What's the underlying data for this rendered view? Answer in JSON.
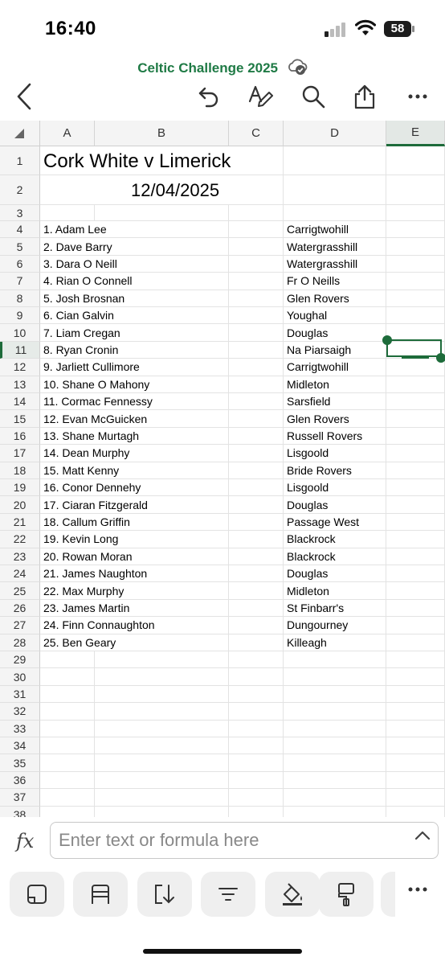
{
  "status": {
    "time": "16:40",
    "battery": "58"
  },
  "document": {
    "title": "Celtic Challenge 2025"
  },
  "toolbar": {
    "icons": [
      "back-icon",
      "undo-icon",
      "pen-format-icon",
      "search-icon",
      "share-icon",
      "more-icon"
    ]
  },
  "columns": [
    "A",
    "B",
    "C",
    "D",
    "E"
  ],
  "selected_cell": "E11",
  "sheet": {
    "title": "Cork White v Limerick",
    "date": "12/04/2025",
    "rows": [
      {
        "row": "1"
      },
      {
        "row": "2"
      },
      {
        "row": "3"
      },
      {
        "row": "4",
        "name": "1. Adam Lee",
        "club": "Carrigtwohill"
      },
      {
        "row": "5",
        "name": "2. Dave Barry",
        "club": "Watergrasshill"
      },
      {
        "row": "6",
        "name": "3. Dara O Neill",
        "club": "Watergrasshill"
      },
      {
        "row": "7",
        "name": "4. Rian O Connell",
        "club": "Fr O Neills"
      },
      {
        "row": "8",
        "name": "5. Josh Brosnan",
        "club": "Glen Rovers"
      },
      {
        "row": "9",
        "name": "6. Cian Galvin",
        "club": "Youghal"
      },
      {
        "row": "10",
        "name": "7. Liam Cregan",
        "club": "Douglas"
      },
      {
        "row": "11",
        "name": "8. Ryan Cronin",
        "club": "Na Piarsaigh"
      },
      {
        "row": "12",
        "name": "9. Jarliett Cullimore",
        "club": "Carrigtwohill"
      },
      {
        "row": "13",
        "name": "10. Shane O Mahony",
        "club": "Midleton"
      },
      {
        "row": "14",
        "name": "11. Cormac Fennessy",
        "club": "Sarsfield"
      },
      {
        "row": "15",
        "name": "12. Evan McGuicken",
        "club": "Glen Rovers"
      },
      {
        "row": "16",
        "name": "13. Shane Murtagh",
        "club": "Russell Rovers"
      },
      {
        "row": "17",
        "name": "14. Dean Murphy",
        "club": "Lisgoold"
      },
      {
        "row": "18",
        "name": "15. Matt Kenny",
        "club": "Bride Rovers"
      },
      {
        "row": "19",
        "name": "16. Conor Dennehy",
        "club": "Lisgoold"
      },
      {
        "row": "20",
        "name": "17. Ciaran Fitzgerald",
        "club": "Douglas"
      },
      {
        "row": "21",
        "name": "18. Callum Griffin",
        "club": "Passage West"
      },
      {
        "row": "22",
        "name": "19. Kevin Long",
        "club": "Blackrock"
      },
      {
        "row": "23",
        "name": "20. Rowan Moran",
        "club": "Blackrock"
      },
      {
        "row": "24",
        "name": "21. James Naughton",
        "club": "Douglas"
      },
      {
        "row": "25",
        "name": "22. Max Murphy",
        "club": "Midleton"
      },
      {
        "row": "26",
        "name": "23. James Martin",
        "club": "St Finbarr's"
      },
      {
        "row": "27",
        "name": "24. Finn Connaughton",
        "club": "Dungourney"
      },
      {
        "row": "28",
        "name": "25. Ben Geary",
        "club": "Killeagh"
      },
      {
        "row": "29"
      },
      {
        "row": "30"
      },
      {
        "row": "31"
      },
      {
        "row": "32"
      },
      {
        "row": "33"
      },
      {
        "row": "34"
      },
      {
        "row": "35"
      },
      {
        "row": "36"
      },
      {
        "row": "37"
      },
      {
        "row": "38"
      }
    ]
  },
  "formula_bar": {
    "fx_label": "fx",
    "placeholder": "Enter text or formula here"
  },
  "bottom_toolbar": {
    "icons": [
      "card-view-icon",
      "insert-rows-icon",
      "insert-columns-icon",
      "filter-icon",
      "fill-color-icon",
      "format-painter-icon",
      "more-icon"
    ]
  }
}
